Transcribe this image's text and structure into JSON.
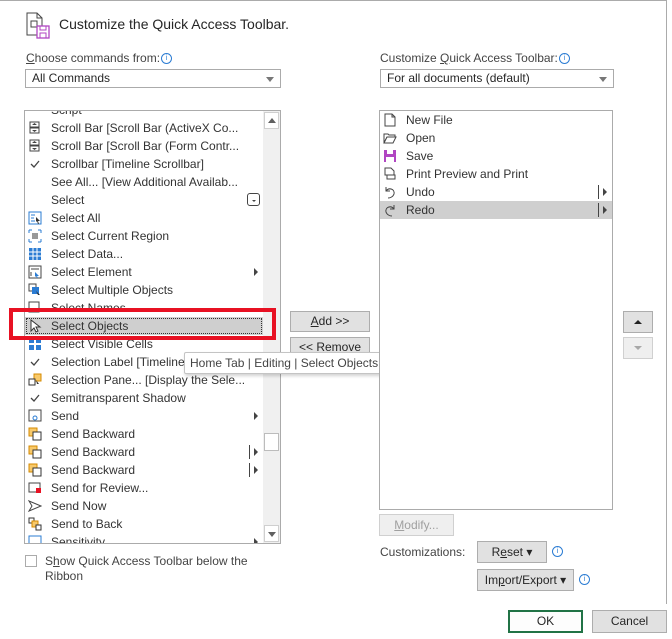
{
  "header": {
    "title": "Customize the Quick Access Toolbar.",
    "icon": "customize-qat-icon"
  },
  "left": {
    "label_prefix": "",
    "label_underlined": "C",
    "label_rest": "hoose commands from:",
    "combo_value": "All Commands",
    "items": [
      {
        "label": "Script",
        "icon": "script-icon",
        "partial": true
      },
      {
        "label": "Scroll Bar [Scroll Bar (ActiveX Co...",
        "icon": "scrollbar-activex-icon"
      },
      {
        "label": "Scroll Bar [Scroll Bar (Form Contr...",
        "icon": "scrollbar-form-icon"
      },
      {
        "label": "Scrollbar [Timeline Scrollbar]",
        "icon": "check-icon"
      },
      {
        "label": "See All... [View Additional Availab...",
        "icon": ""
      },
      {
        "label": "Select",
        "icon": "",
        "dropdown": true
      },
      {
        "label": "Select All",
        "icon": "select-all-icon"
      },
      {
        "label": "Select Current Region",
        "icon": "select-region-icon"
      },
      {
        "label": "Select Data...",
        "icon": "select-data-icon"
      },
      {
        "label": "Select Element",
        "icon": "select-element-icon",
        "submenu": true
      },
      {
        "label": "Select Multiple Objects",
        "icon": "select-multiple-icon"
      },
      {
        "label": "Select Names",
        "icon": "select-names-icon"
      },
      {
        "label": "Select Objects",
        "icon": "cursor-arrow-icon",
        "selected": true
      },
      {
        "label": "Select Visible Cells",
        "icon": "visible-cells-icon"
      },
      {
        "label": "Selection Label [Timeline",
        "icon": "check-icon"
      },
      {
        "label": "Selection Pane... [Display the Sele...",
        "icon": "selection-pane-icon"
      },
      {
        "label": "Semitransparent Shadow",
        "icon": "check-icon"
      },
      {
        "label": "Send",
        "icon": "send-icon",
        "submenu": true
      },
      {
        "label": "Send Backward",
        "icon": "send-backward-icon"
      },
      {
        "label": "Send Backward",
        "icon": "send-backward-icon",
        "split": true
      },
      {
        "label": "Send Backward",
        "icon": "send-backward-icon",
        "split": true
      },
      {
        "label": "Send for Review...",
        "icon": "send-review-icon"
      },
      {
        "label": "Send Now",
        "icon": "send-now-icon"
      },
      {
        "label": "Send to Back",
        "icon": "send-to-back-icon"
      },
      {
        "label": "Sensitivity",
        "icon": "sensitivity-icon",
        "submenu": true,
        "partial": true
      }
    ],
    "checkbox_u": "h",
    "checkbox_pre": "S",
    "checkbox_post": "ow Quick Access Toolbar below the",
    "checkbox_line2": "Ribbon",
    "checkbox_checked": false
  },
  "middle": {
    "add_u": "A",
    "add_rest": "dd >>",
    "remove": "<< Remove"
  },
  "tooltip": "Home Tab | Editing | Select Objects (ObjectsSelect)",
  "right": {
    "label_pre": "Customize ",
    "label_u": "Q",
    "label_rest": "uick Access Toolbar:",
    "combo_value": "For all documents (default)",
    "items": [
      {
        "label": "New File",
        "icon": "new-file-icon"
      },
      {
        "label": "Open",
        "icon": "open-folder-icon"
      },
      {
        "label": "Save",
        "icon": "save-icon"
      },
      {
        "label": "Print Preview and Print",
        "icon": "print-preview-icon"
      },
      {
        "label": "Undo",
        "icon": "undo-icon",
        "split": true
      },
      {
        "label": "Redo",
        "icon": "redo-icon",
        "split": true,
        "selected": true
      }
    ],
    "modify_u": "M",
    "modify_rest": "odify...",
    "customizations_label": "Customizations:",
    "reset_pre": "R",
    "reset_u": "e",
    "reset_rest": "set ▾",
    "import_pre": "Im",
    "import_u": "p",
    "import_rest": "ort/Export ▾"
  },
  "footer": {
    "ok": "OK",
    "cancel": "Cancel"
  },
  "colors": {
    "accent_border": "#217346",
    "highlight": "#e81123",
    "save_icon": "#b146c2"
  }
}
